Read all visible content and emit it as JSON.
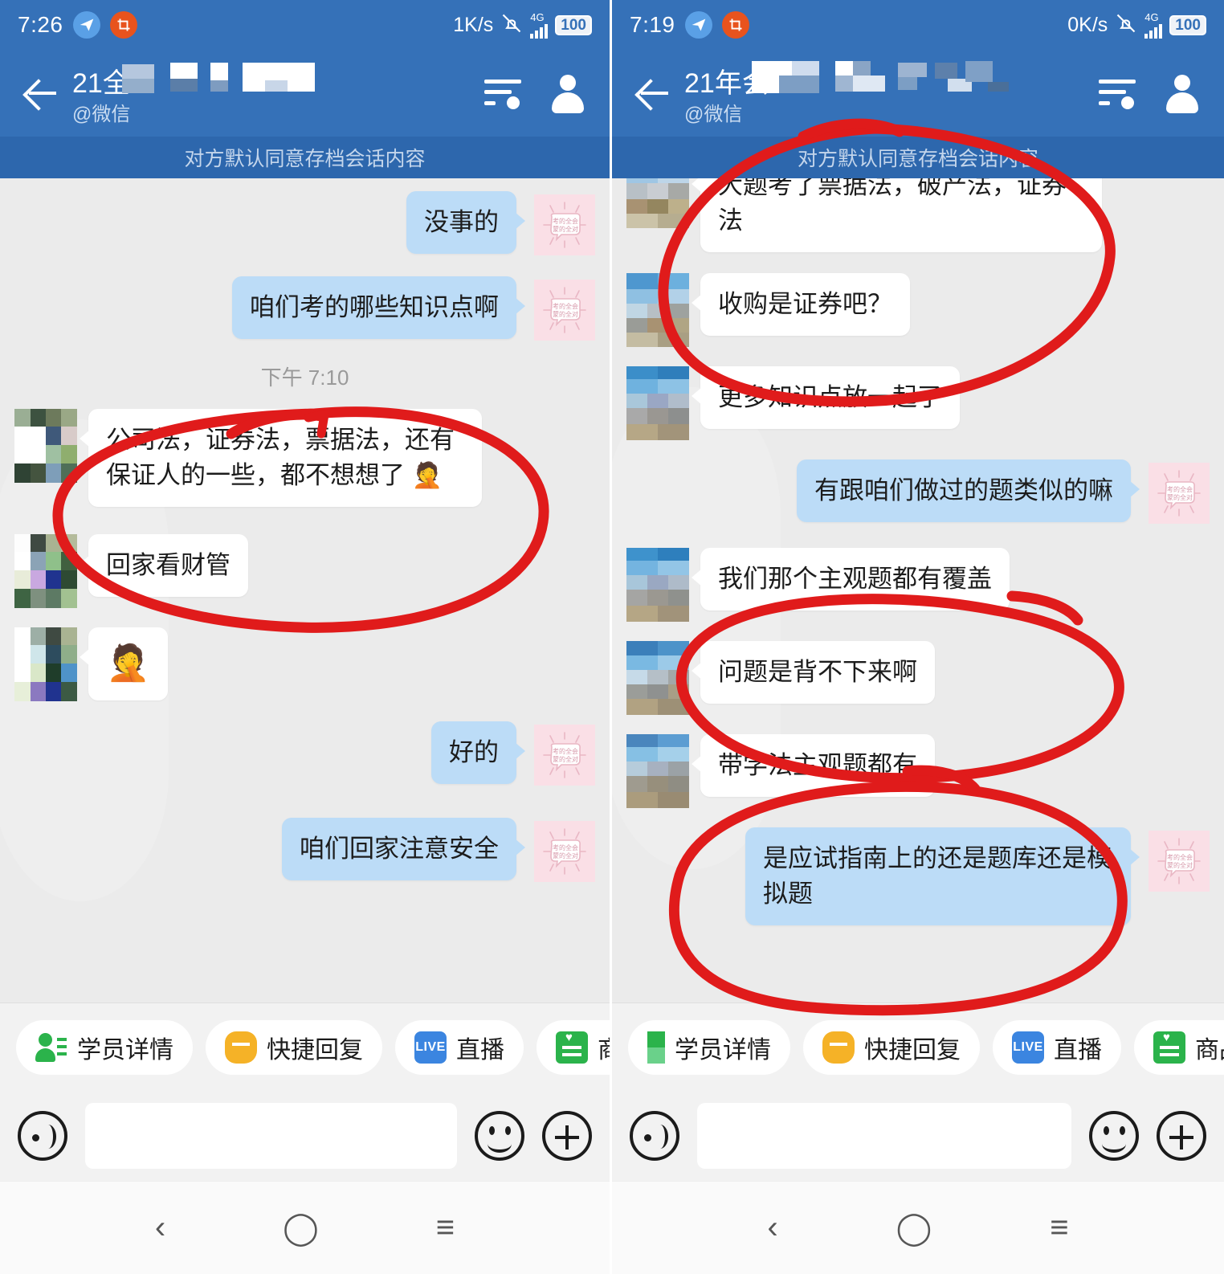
{
  "panels": [
    {
      "status": {
        "time": "7:26",
        "net_speed": "1K/s",
        "network": "4G",
        "battery": "100"
      },
      "header": {
        "title_prefix": "21全",
        "subtitle": "@微信",
        "filter_icon": "filter-icon",
        "profile_icon": "person-icon",
        "back_icon": "back-arrow-icon"
      },
      "banner": "对方默认同意存档会话内容",
      "timestamp": "下午 7:10",
      "messages": [
        {
          "side": "out",
          "text": "没事的"
        },
        {
          "side": "out",
          "text": "咱们考的哪些知识点啊"
        },
        {
          "side": "time",
          "text": "下午 7:10"
        },
        {
          "side": "in",
          "text": "公司法，证券法，票据法，还有保证人的一些，都不想想了 🤦"
        },
        {
          "side": "in",
          "text": "回家看财管"
        },
        {
          "side": "in",
          "text": "🤦",
          "emoji": true
        },
        {
          "side": "out",
          "text": "好的"
        },
        {
          "side": "out",
          "text": "咱们回家注意安全"
        }
      ],
      "toolbar": [
        {
          "label": "学员详情",
          "icon": "student-details-icon"
        },
        {
          "label": "快捷回复",
          "icon": "quick-reply-icon"
        },
        {
          "label": "直播",
          "icon": "live-icon"
        },
        {
          "label": "商品图册",
          "icon": "product-catalog-icon"
        }
      ],
      "input": {
        "voice_icon": "voice-icon",
        "placeholder": "",
        "value": "",
        "emoji_icon": "smiley-icon",
        "plus_icon": "plus-icon"
      }
    },
    {
      "status": {
        "time": "7:19",
        "net_speed": "0K/s",
        "network": "4G",
        "battery": "100"
      },
      "header": {
        "title_prefix": "21年会",
        "subtitle": "@微信",
        "filter_icon": "filter-icon",
        "profile_icon": "person-icon",
        "back_icon": "back-arrow-icon"
      },
      "banner": "对方默认同意存档会话内容",
      "messages": [
        {
          "side": "in",
          "text": "大题考了票据法，破产法，证券法"
        },
        {
          "side": "in",
          "text": "收购是证券吧？"
        },
        {
          "side": "in",
          "text": "更多知识点放一起了"
        },
        {
          "side": "out",
          "text": "有跟咱们做过的题类似的嘛"
        },
        {
          "side": "in",
          "text": "我们那个主观题都有覆盖"
        },
        {
          "side": "in",
          "text": "问题是背不下来啊"
        },
        {
          "side": "in",
          "text": "带学法主观题都有"
        },
        {
          "side": "out",
          "text": "是应试指南上的还是题库还是模拟题"
        }
      ],
      "toolbar": [
        {
          "label": "学员详情",
          "icon": "student-details-icon"
        },
        {
          "label": "快捷回复",
          "icon": "quick-reply-icon"
        },
        {
          "label": "直播",
          "icon": "live-icon"
        },
        {
          "label": "商品图册",
          "icon": "product-catalog-icon"
        }
      ],
      "input": {
        "voice_icon": "voice-icon",
        "placeholder": "",
        "value": "",
        "emoji_icon": "smiley-icon",
        "plus_icon": "plus-icon"
      }
    }
  ],
  "navbar": {
    "back": "‹",
    "home": "◯",
    "recents": "≡"
  },
  "sticker_avatar": {
    "line1": "考的全会",
    "line2": "蒙的全对"
  },
  "colors": {
    "header_blue": "#3571b8",
    "banner_blue": "#2d67ad",
    "outgoing_bubble": "#bcdcf7",
    "incoming_bubble": "#ffffff",
    "chat_bg": "#ebebeb",
    "annotation_red": "#e01b1b",
    "accent_green": "#2bb34b",
    "accent_yellow": "#f5b227",
    "accent_blue": "#3b85e0"
  }
}
